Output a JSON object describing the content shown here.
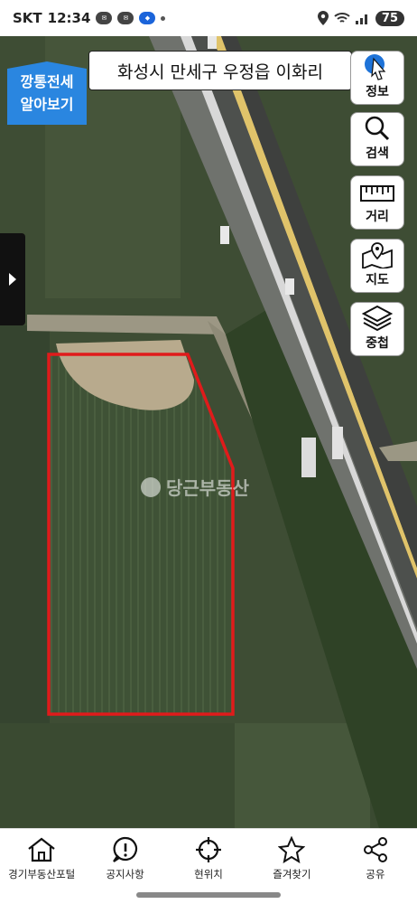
{
  "status_bar": {
    "carrier": "SKT",
    "time": "12:34",
    "battery": "75"
  },
  "map": {
    "address": "화성시 만세구 우정읍 이화리",
    "badge_text": "깡통전세\n알아보기",
    "watermark": "당근부동산",
    "parcel_outline_color": "#e01b1b",
    "badge_color": "#2a86e0"
  },
  "tools": [
    {
      "label": "정보",
      "icon": "info-pin-icon"
    },
    {
      "label": "검색",
      "icon": "magnifier-icon"
    },
    {
      "label": "거리",
      "icon": "ruler-icon"
    },
    {
      "label": "지도",
      "icon": "map-pin-icon"
    },
    {
      "label": "중첩",
      "icon": "layers-icon"
    }
  ],
  "bottom_nav": [
    {
      "label": "경기부동산포털",
      "icon": "home-icon"
    },
    {
      "label": "공지사항",
      "icon": "notice-icon"
    },
    {
      "label": "현위치",
      "icon": "crosshair-icon"
    },
    {
      "label": "즐겨찾기",
      "icon": "star-icon"
    },
    {
      "label": "공유",
      "icon": "share-icon"
    }
  ]
}
